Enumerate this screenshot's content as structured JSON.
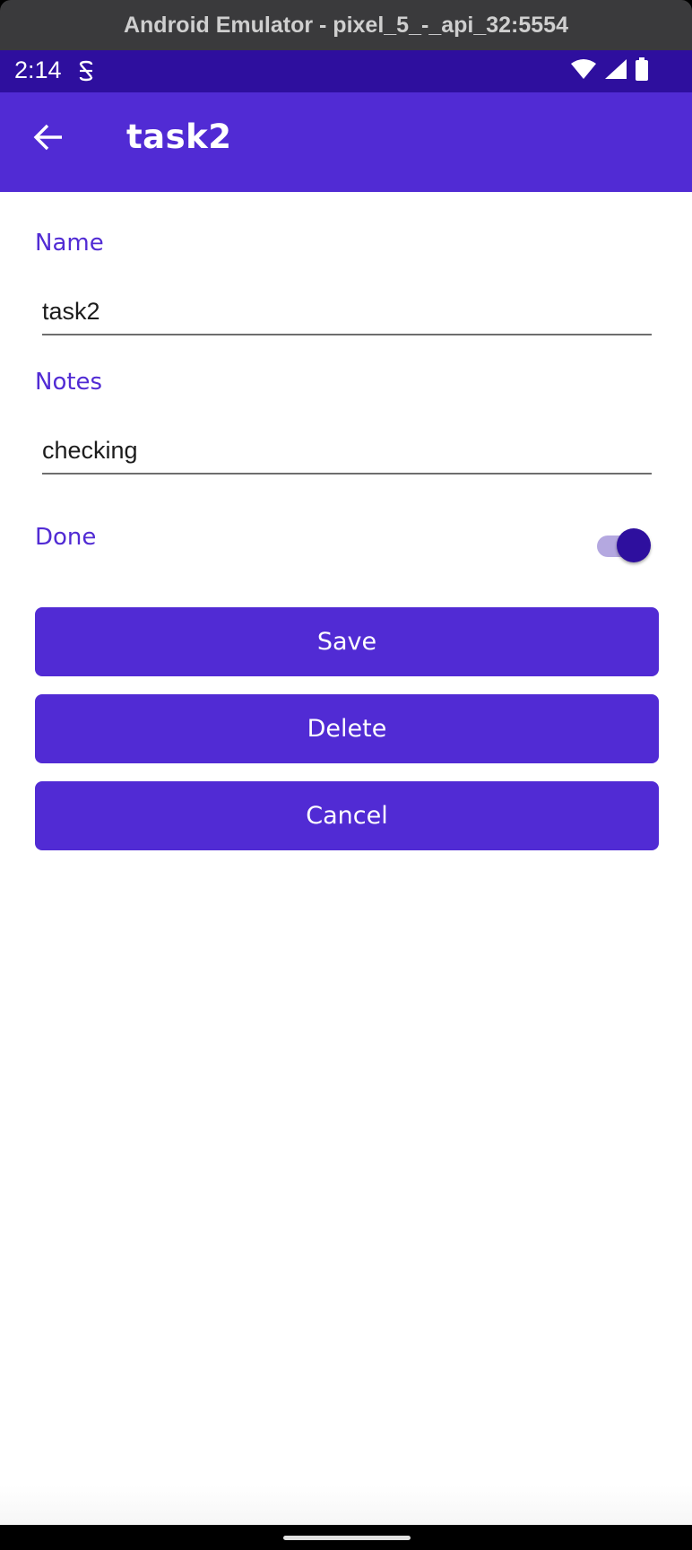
{
  "window": {
    "title": "Android Emulator - pixel_5_-_api_32:5554"
  },
  "status_bar": {
    "time": "2:14",
    "icons": [
      "sync-icon",
      "wifi-icon",
      "signal-icon",
      "battery-icon"
    ]
  },
  "app_bar": {
    "back_icon": "arrow-back-icon",
    "title": "task2"
  },
  "form": {
    "name_label": "Name",
    "name_value": "task2",
    "notes_label": "Notes",
    "notes_value": "checking",
    "done_label": "Done",
    "done_checked": true
  },
  "buttons": {
    "save": "Save",
    "delete": "Delete",
    "cancel": "Cancel"
  },
  "colors": {
    "primary": "#512bd4",
    "primary_dark": "#2e0f9e",
    "switch_track": "#b4a8e0"
  }
}
